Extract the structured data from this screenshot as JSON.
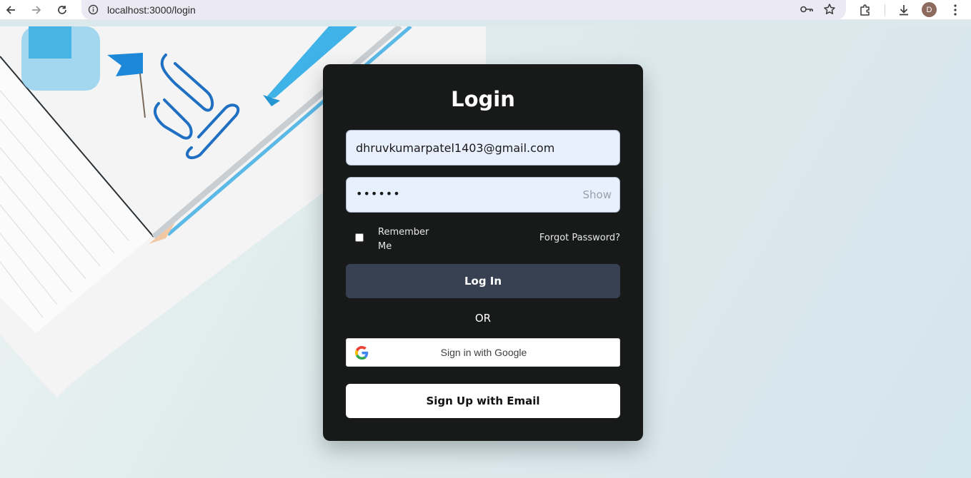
{
  "browser": {
    "url": "localhost:3000/login",
    "profile_initial": "D"
  },
  "login": {
    "title": "Login",
    "email_value": "dhruvkumarpatel1403@gmail.com",
    "password_masked": "••••••",
    "show_label": "Show",
    "remember_label": "Remember Me",
    "forgot_label": "Forgot Password?",
    "login_button": "Log In",
    "or_label": "OR",
    "google_button": "Sign in with Google",
    "signup_button": "Sign Up with Email"
  },
  "colors": {
    "card_bg": "#181a1a",
    "login_button_bg": "#374151",
    "input_bg": "#e8f0fe"
  }
}
